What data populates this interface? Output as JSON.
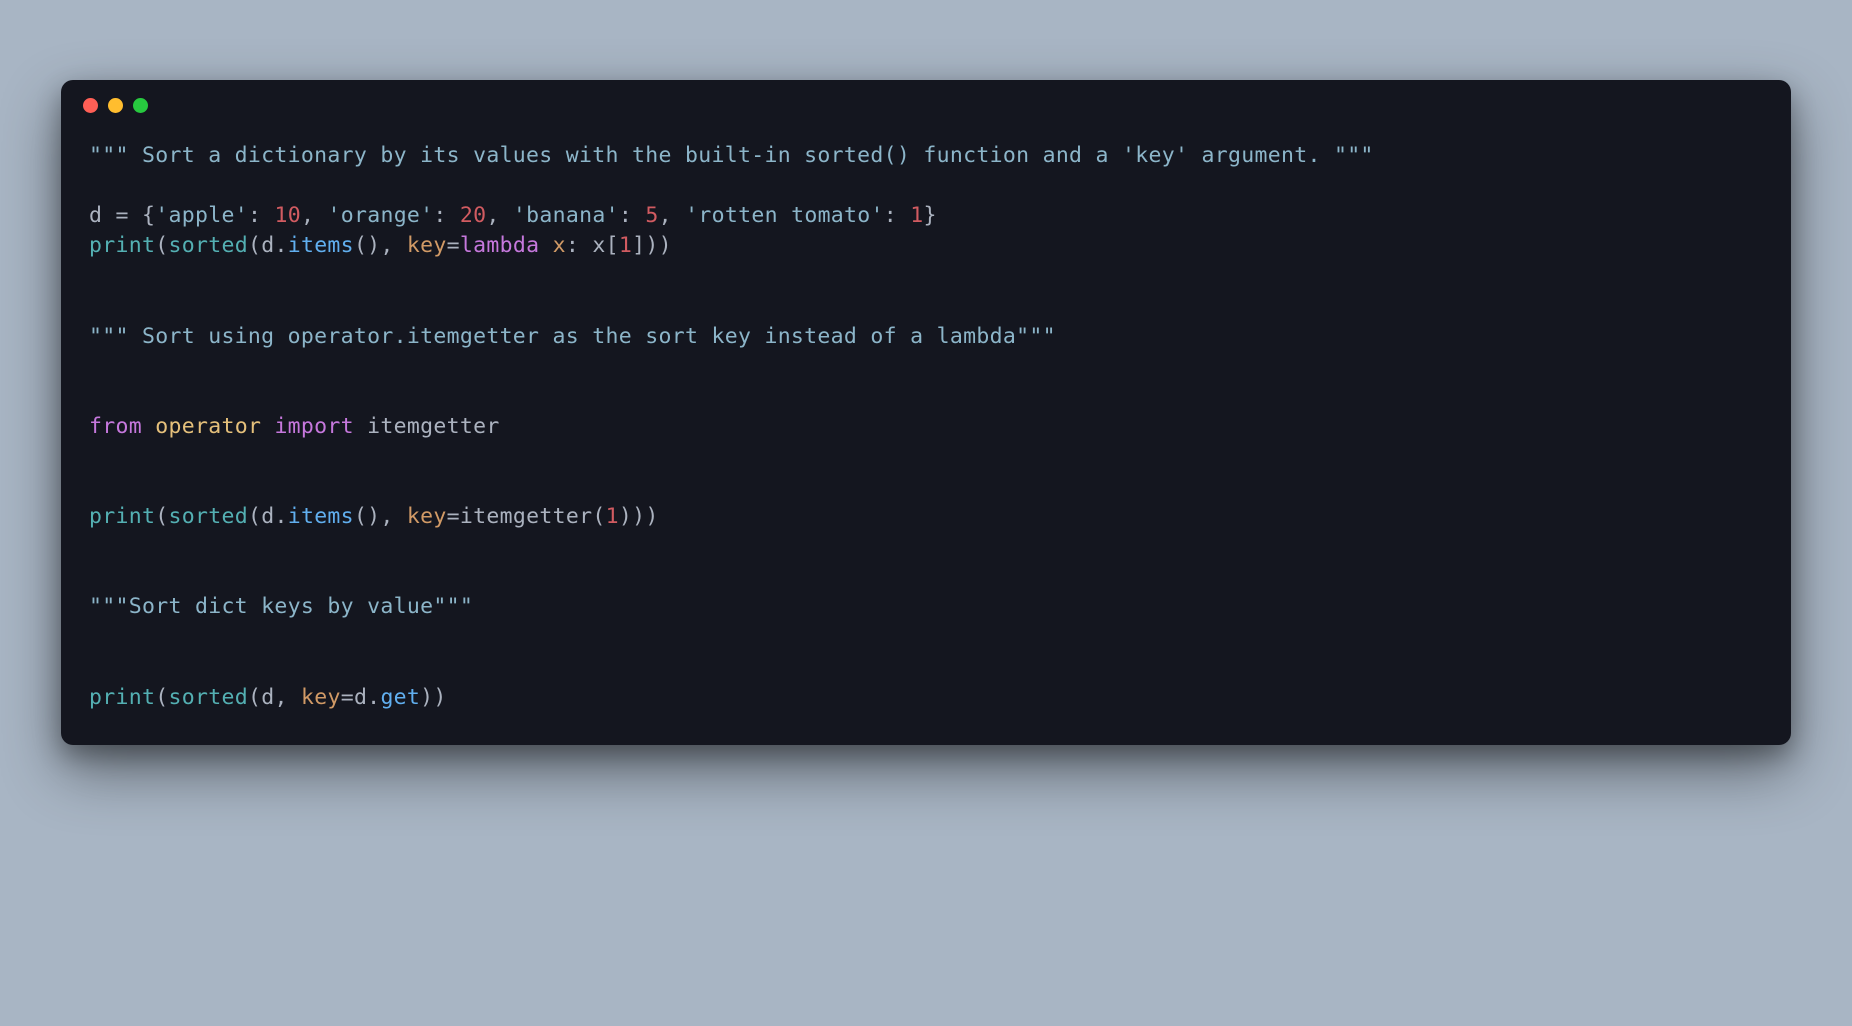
{
  "code": {
    "line1": {
      "docstring": "\"\"\" Sort a dictionary by its values with the built-in sorted() function and a 'key' argument. \"\"\""
    },
    "line3": {
      "var": "d ",
      "eq": "=",
      "sp1": " ",
      "lbrace": "{",
      "str1": "'apple'",
      "colon1": ": ",
      "num1": "10",
      "comma1": ", ",
      "str2": "'orange'",
      "colon2": ": ",
      "num2": "20",
      "comma2": ", ",
      "str3": "'banana'",
      "colon3": ": ",
      "num3": "5",
      "comma3": ", ",
      "str4": "'rotten tomato'",
      "colon4": ": ",
      "num4": "1",
      "rbrace": "}"
    },
    "line4": {
      "print": "print",
      "lp1": "(",
      "sorted": "sorted",
      "lp2": "(",
      "d": "d.",
      "items": "items",
      "parens": "(), ",
      "key": "key",
      "eq": "=",
      "lambda": "lambda",
      "sp": " ",
      "x": "x",
      "colon": ": ",
      "x2": "x",
      "lb": "[",
      "idx": "1",
      "rb": "]))"
    },
    "line7": {
      "docstring": "\"\"\" Sort using operator.itemgetter as the sort key instead of a lambda\"\"\""
    },
    "line10": {
      "from": "from",
      "sp1": " ",
      "operator": "operator",
      "sp2": " ",
      "import": "import",
      "sp3": " ",
      "itemgetter": "itemgetter"
    },
    "line13": {
      "print": "print",
      "lp1": "(",
      "sorted": "sorted",
      "lp2": "(",
      "d": "d.",
      "items": "items",
      "parens": "(), ",
      "key": "key",
      "eq": "=",
      "itemgetter": "itemgetter",
      "lp3": "(",
      "idx": "1",
      "rp": ")))"
    },
    "line16": {
      "docstring": "\"\"\"Sort dict keys by value\"\"\""
    },
    "line19": {
      "print": "print",
      "lp1": "(",
      "sorted": "sorted",
      "lp2": "(",
      "d": "d",
      "comma": ", ",
      "key": "key",
      "eq": "=",
      "d2": "d.",
      "get": "get",
      "rp": "))"
    }
  }
}
